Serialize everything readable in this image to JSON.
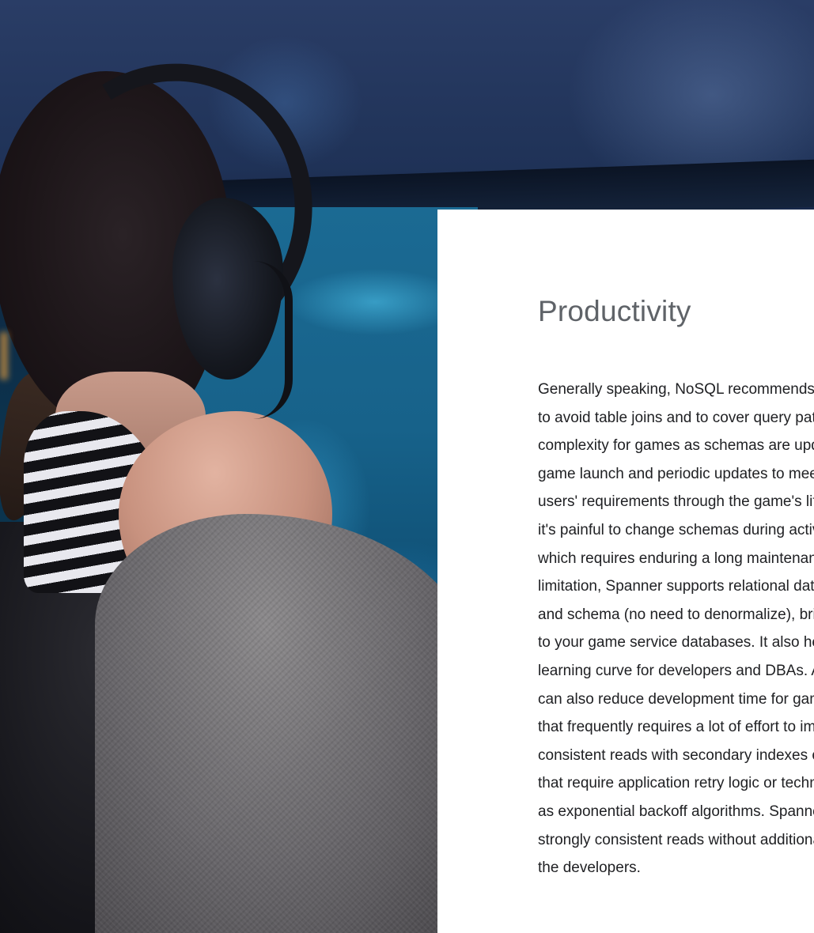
{
  "section": {
    "title": "Productivity",
    "body_lines": [
      "Generally speaking, NoSQL recommends denormalization",
      "to avoid table joins and to cover query patterns, adding",
      "complexity for games as schemas are updated between",
      "game launch and periodic updates to meet the evolving",
      "users' requirements through the game's life cycle. And",
      "it's painful to change schemas during active service,",
      "which requires enduring a long maintenance. To address this",
      "limitation, Spanner supports relational data modeling",
      "and schema (no need to denormalize), bringing flexibility",
      "to your game service databases. It also helps reduce the",
      "learning curve for developers and DBAs. Additionally, Spanner",
      "can also reduce development time for game developers",
      "that frequently requires a lot of effort to implement",
      "consistent reads with secondary indexes or transactions",
      "that require application retry logic or techniques such",
      "as exponential backoff algorithms. Spanner provides",
      "strongly consistent reads without additional effort for",
      "the developers."
    ]
  },
  "colors": {
    "card_background": "#ffffff",
    "title_color": "#5f6368",
    "body_color": "#202124"
  }
}
